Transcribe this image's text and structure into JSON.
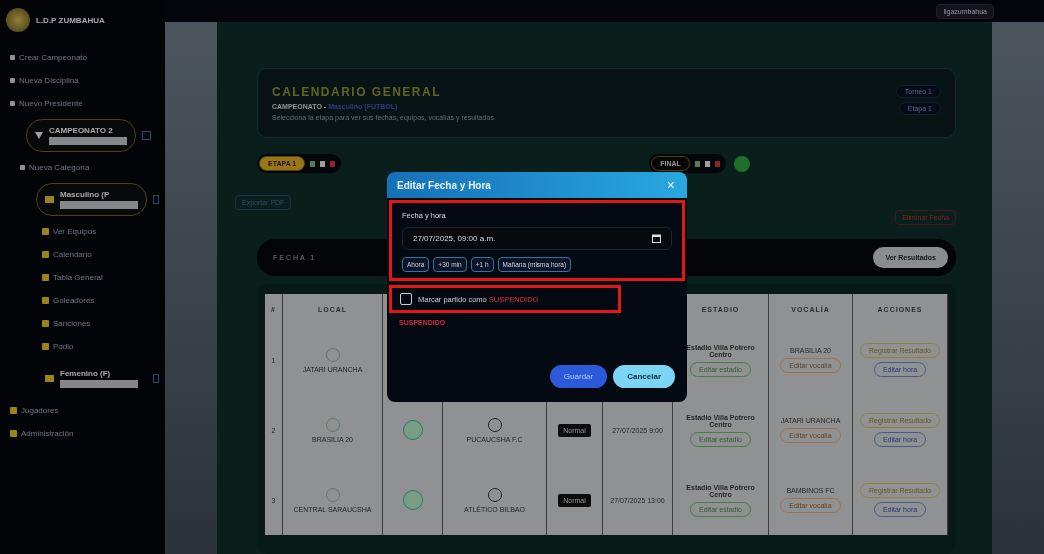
{
  "sidebar": {
    "brand": "L.D.P ZUMBAHUA",
    "menu": [
      {
        "label": "Crear Campeonato"
      },
      {
        "label": "Nueva Disciplina"
      },
      {
        "label": "Nuevo Presidente"
      }
    ],
    "championship": {
      "label": "CAMPEONATO 2",
      "expanded": true,
      "new_category": "Nueva Categoría",
      "categories": [
        {
          "label": "Masculino (P",
          "expanded": true,
          "children": [
            {
              "label": "Ver Equipos"
            },
            {
              "label": "Calendario"
            },
            {
              "label": "Tabla General"
            },
            {
              "label": "Goleadores"
            },
            {
              "label": "Sanciones"
            },
            {
              "label": "Podio"
            }
          ]
        },
        {
          "label": "Femenino (F)",
          "expanded": false
        }
      ]
    },
    "footer": [
      {
        "label": "Jugadores"
      },
      {
        "label": "Administración"
      }
    ]
  },
  "topbar": {
    "user": "ligazumbahua"
  },
  "header": {
    "title": "CALENDARIO GENERAL",
    "subtitle_label": "CAMPEONATO -",
    "subtitle_value": "Masculino (FUTBOL)",
    "description": "Selecciona la etapa para ver sus fechas, equipos, vocalías y resultados.",
    "badges": [
      "Torneo 1",
      "Etapa 1"
    ]
  },
  "stages": [
    {
      "label": "ETAPA 1",
      "selected": true
    },
    {
      "label": "FINAL",
      "selected": false
    }
  ],
  "export_button": "Exportar PDF",
  "delete_button": "Eliminar Fecha",
  "round": {
    "title": "FECHA 1",
    "results_button": "Ver Resultados"
  },
  "table": {
    "columns": [
      "#",
      "LOCAL",
      "ESTADIO",
      "VOCALÍA",
      "ACCIONES"
    ],
    "rows": [
      {
        "number": "1",
        "local": "JATARI URANCHA",
        "venue": "Estadio Villa Potrero Centro",
        "venue_action": "Editar estadio",
        "referee": "BRASILIA 20",
        "referee_action": "Editar vocalía",
        "result_action": "Registrar Resultado",
        "time_action": "Editar hora"
      },
      {
        "number": "2",
        "local": "BRASILIA 20",
        "visitor": "PUCAUCSHA F.C",
        "type": "Normal",
        "datetime": "27/07/2025 9:00",
        "venue": "Estadio Villa Potrero Centro",
        "venue_action": "Editar estadio",
        "referee": "JATARI URANCHA",
        "referee_action": "Editar vocalía",
        "result_action": "Registrar Resultado",
        "time_action": "Editar hora"
      },
      {
        "number": "3",
        "local": "CENTRAL SARAUCSHA",
        "visitor": "ATLÉTICO BILBAO",
        "type": "Normal",
        "datetime": "27/07/2025 13:00",
        "venue": "Estadio Villa Potrero Centro",
        "venue_action": "Editar estadio",
        "referee": "BAMBINOS FC",
        "referee_action": "Editar vocalía",
        "result_action": "Registrar Resultado",
        "time_action": "Editar hora"
      }
    ]
  },
  "dialog": {
    "title": "Editar Fecha y Hora",
    "field_label": "Fecha y hora",
    "value": "27/07/2025, 09:00 a.m.",
    "quick_buttons": [
      "Ahora",
      "+30 min",
      "+1 h",
      "Mañana (misma hora)"
    ],
    "suspend_label": "Marcar partido como",
    "suspend_word": "SUSPENDIDO",
    "suspended": false,
    "close": "×",
    "status": "SUSPENDIDO",
    "save": "Guardar",
    "cancel": "Cancelar"
  }
}
